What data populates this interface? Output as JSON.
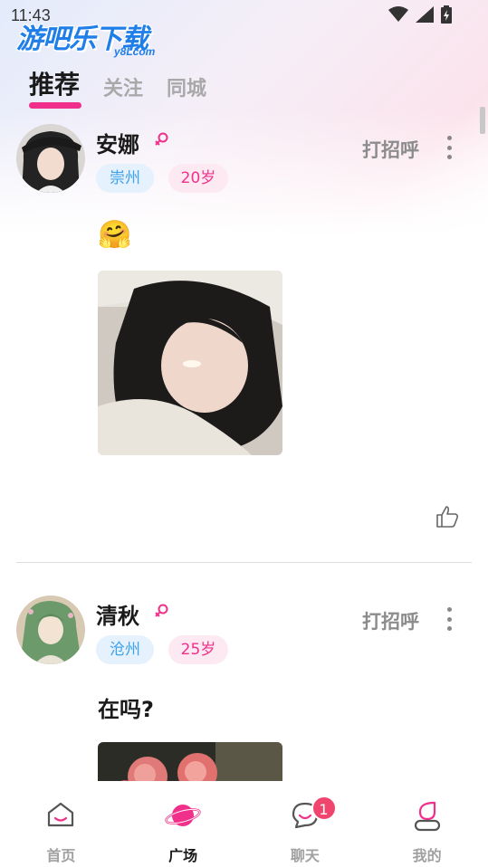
{
  "status_bar": {
    "time": "11:43"
  },
  "watermark": {
    "main": "游吧乐下载",
    "sub": "y8Lcom"
  },
  "tabs": [
    {
      "label": "推荐",
      "active": true
    },
    {
      "label": "关注",
      "active": false
    },
    {
      "label": "同城",
      "active": false
    }
  ],
  "posts": [
    {
      "username": "安娜",
      "gender_icon": "female-icon",
      "city": "崇州",
      "age": "20岁",
      "greet_label": "打招呼",
      "content": "🤗",
      "has_photo": true,
      "like_icon": "thumbs-up-icon"
    },
    {
      "username": "清秋",
      "gender_icon": "female-icon",
      "city": "沧州",
      "age": "25岁",
      "greet_label": "打招呼",
      "content": "在吗?",
      "has_photo": true
    }
  ],
  "bottom_nav": [
    {
      "label": "首页",
      "icon": "home-icon",
      "active": false
    },
    {
      "label": "广场",
      "icon": "planet-icon",
      "active": true
    },
    {
      "label": "聊天",
      "icon": "chat-icon",
      "active": false,
      "badge": "1"
    },
    {
      "label": "我的",
      "icon": "profile-icon",
      "active": false
    }
  ],
  "colors": {
    "accent": "#f0308a",
    "city_tag_bg": "#e5f2fd",
    "city_tag_text": "#3ea1ec",
    "age_tag_bg": "#fde9f2",
    "badge": "#f0466e"
  }
}
